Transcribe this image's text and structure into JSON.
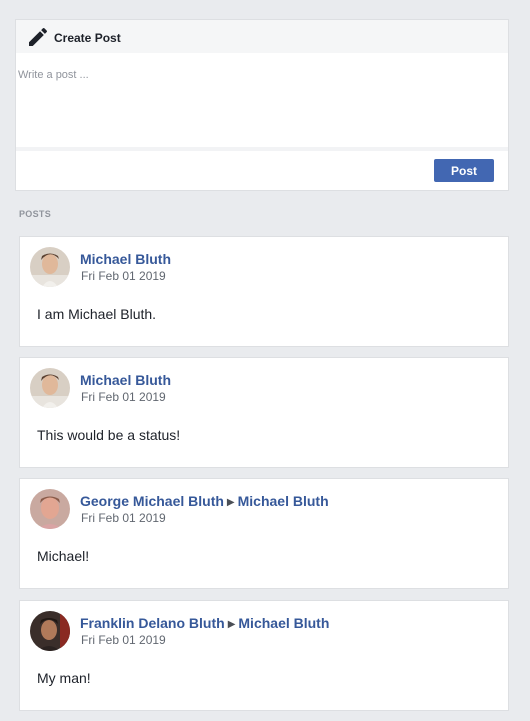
{
  "composer": {
    "title": "Create Post",
    "placeholder": "Write a post ...",
    "post_button": "Post",
    "icon": "pencil-icon"
  },
  "posts_section_label": "POSTS",
  "posts": [
    {
      "author": "Michael Bluth",
      "target": "",
      "date": "Fri Feb 01 2019",
      "text": "I am Michael Bluth."
    },
    {
      "author": "Michael Bluth",
      "target": "",
      "date": "Fri Feb 01 2019",
      "text": "This would be a status!"
    },
    {
      "author": "George Michael Bluth",
      "target": "Michael Bluth",
      "date": "Fri Feb 01 2019",
      "text": "Michael!"
    },
    {
      "author": "Franklin Delano Bluth",
      "target": "Michael Bluth",
      "date": "Fri Feb 01 2019",
      "text": "My man!"
    }
  ],
  "colors": {
    "page_bg": "#e9ebee",
    "link": "#365899",
    "button": "#4267b2"
  }
}
